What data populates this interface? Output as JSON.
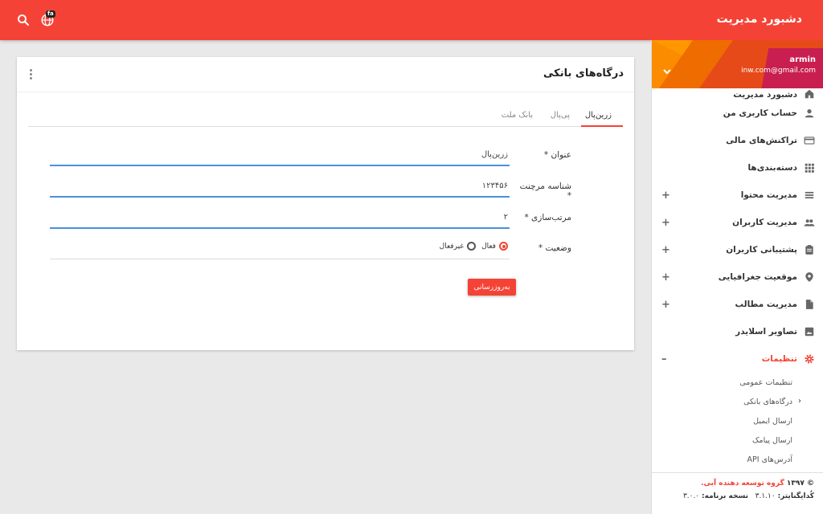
{
  "header": {
    "title": "دشبورد مدیریت",
    "language_badge": "fa"
  },
  "profile": {
    "username": "armin",
    "email": "inw.com@gmail.com"
  },
  "sidebar": {
    "items": [
      {
        "label": "دشبورد مدیریت",
        "icon": "home-icon"
      },
      {
        "label": "حساب کاربری من",
        "icon": "person-icon"
      },
      {
        "label": "تراکنش‌های مالی",
        "icon": "credit-card-icon"
      },
      {
        "label": "دسته‌بندی‌ها",
        "icon": "grid-icon"
      },
      {
        "label": "مدیریت محتوا",
        "icon": "list-icon",
        "expand": "+"
      },
      {
        "label": "مدیریت کاربران",
        "icon": "people-icon",
        "expand": "+"
      },
      {
        "label": "پشتیبانی کاربران",
        "icon": "clipboard-icon",
        "expand": "+"
      },
      {
        "label": "موقعیت جغرافیایی",
        "icon": "location-icon",
        "expand": "+"
      },
      {
        "label": "مدیریت مطالب",
        "icon": "document-icon",
        "expand": "+"
      },
      {
        "label": "تصاویر اسلایدر",
        "icon": "image-icon"
      },
      {
        "label": "تنظیمات",
        "icon": "gear-icon",
        "expand": "–"
      }
    ],
    "settings_sub": [
      "تنظیمات عمومی",
      "درگاه‌های بانکی",
      "ارسال ایمیل",
      "ارسال پیامک",
      "آدرس‌های API"
    ]
  },
  "footer": {
    "copyright_prefix": "© ۱۳۹۷",
    "brand": "گروه توسعه دهنده آبی.",
    "codeigniter_label": "کُدایگنایتر:",
    "codeigniter_version": "۳.۱.۱۰",
    "app_version_label": "نسخه برنامه:",
    "app_version": "۳.۰.۰"
  },
  "card": {
    "title": "درگاه‌های بانکی",
    "tabs": [
      "زرین‌پال",
      "پی‌پال",
      "بانک ملت"
    ],
    "form": {
      "title_label": "عنوان *",
      "title_value": "زرین‌پال",
      "merchant_label": "شناسه مرچنت *",
      "merchant_value": "۱۲۳۴۵۶",
      "order_label": "مرتب‌سازی *",
      "order_value": "۲",
      "status_label": "وضعیت *",
      "status_active": "فعال",
      "status_inactive": "غیرفعال",
      "status_selected": "فعال"
    },
    "submit_label": "به‌روزرسانی"
  },
  "colors": {
    "primary": "#f44336",
    "input_underline": "#4a90e2"
  }
}
